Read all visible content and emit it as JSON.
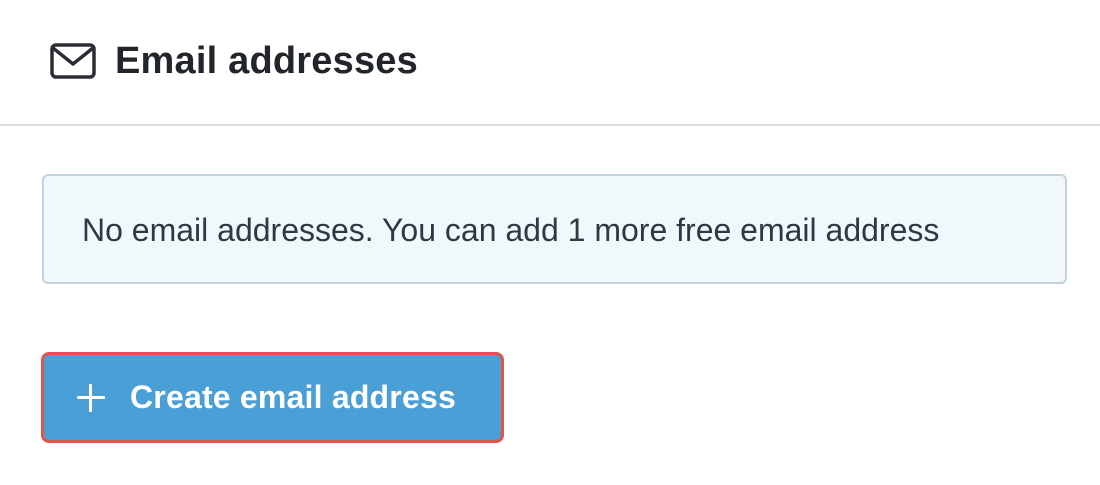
{
  "header": {
    "icon": "envelope-icon",
    "title": "Email addresses"
  },
  "notice": {
    "text": "No email addresses. You can add 1 more free email address"
  },
  "create_button": {
    "icon": "plus-icon",
    "label": "Create email address",
    "background_color": "#4a9fd6",
    "highlight_border_color": "#e0544a"
  }
}
